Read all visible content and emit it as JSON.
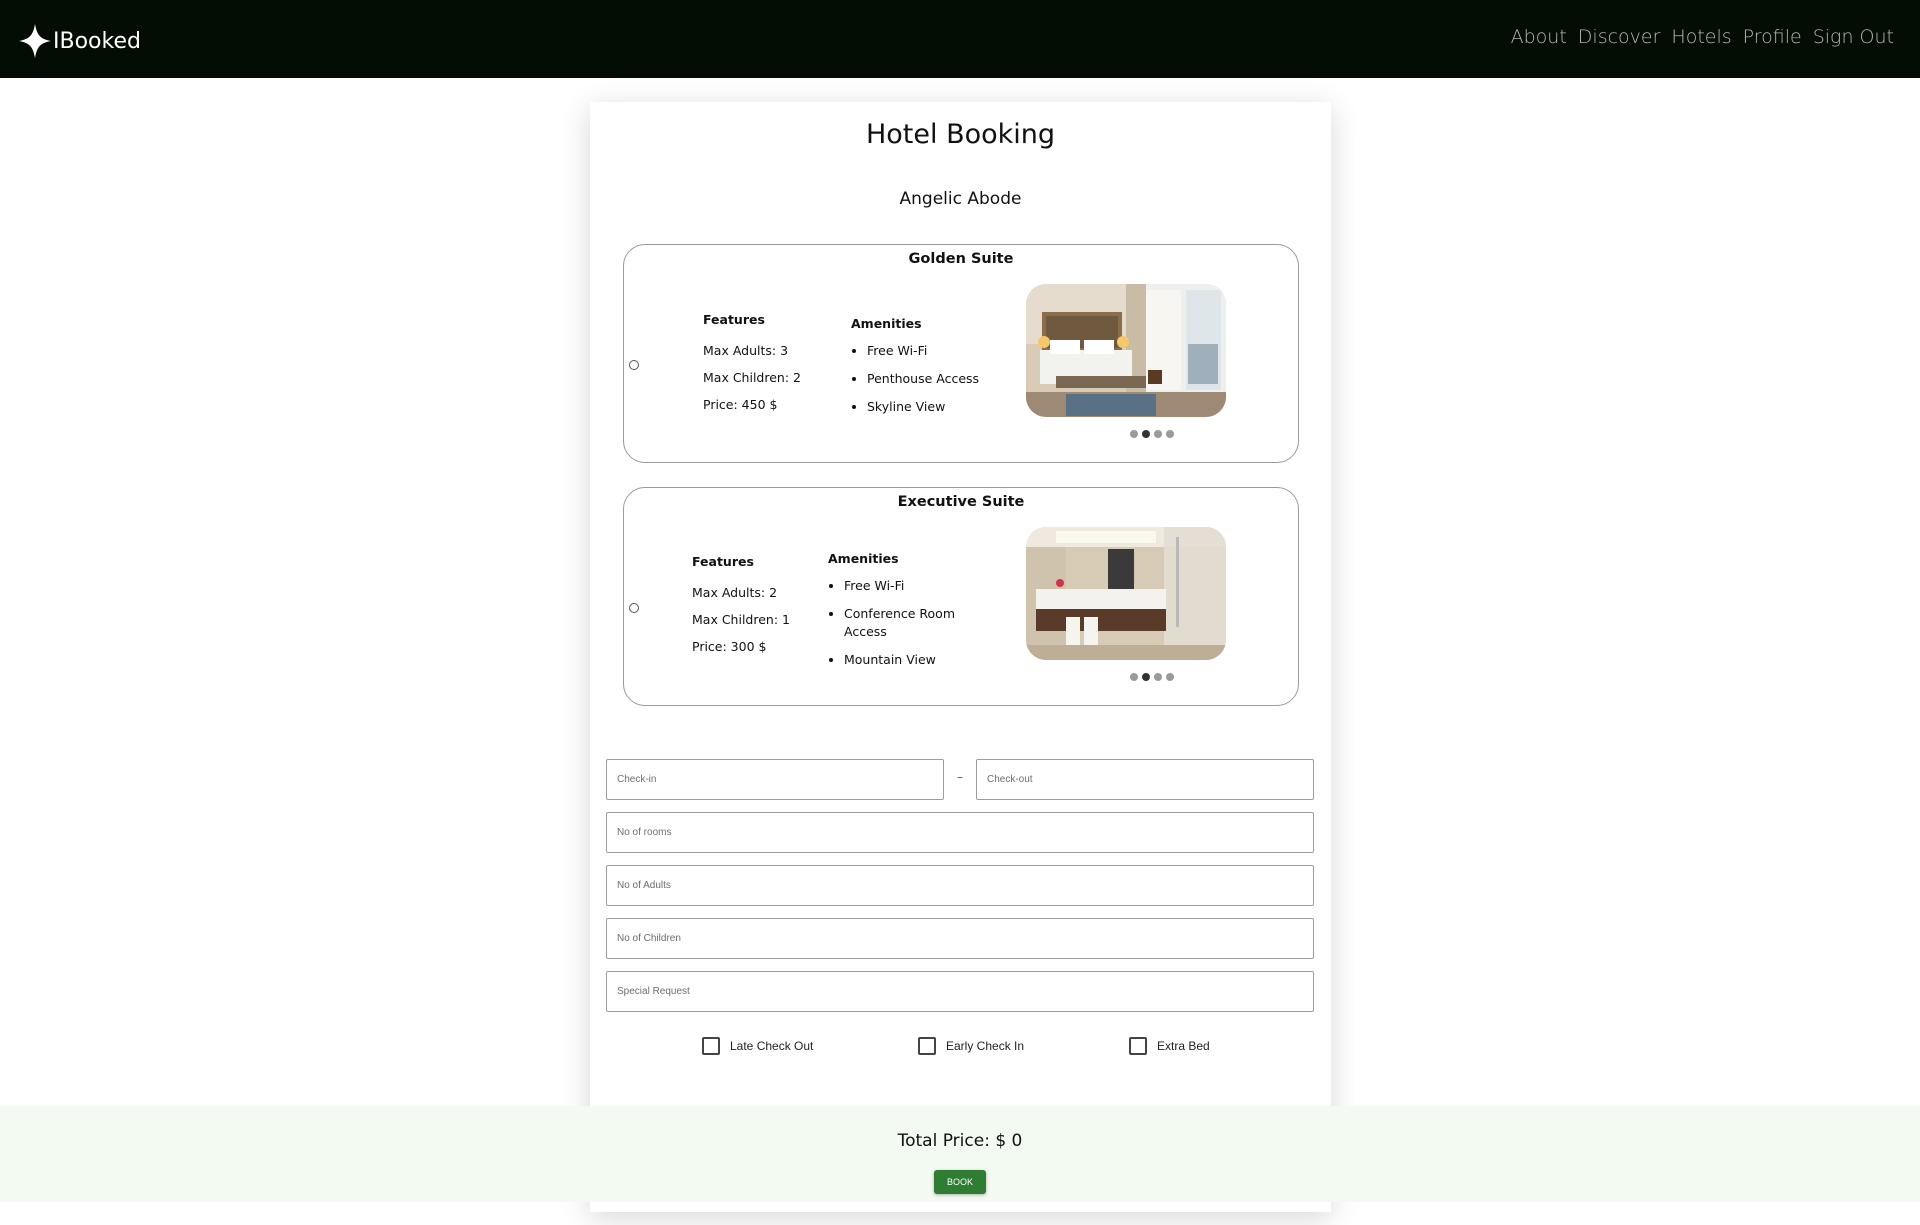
{
  "nav": {
    "brand": "IBooked",
    "links": [
      "About",
      "Discover",
      "Hotels",
      "Profile",
      "Sign Out"
    ]
  },
  "page": {
    "title": "Hotel Booking",
    "hotel_name": "Angelic Abode"
  },
  "rooms": [
    {
      "name": "Golden Suite",
      "features_heading": "Features",
      "features": [
        "Max Adults: 3",
        "Max Children: 2",
        "Price: 450 $"
      ],
      "amenities_heading": "Amenities",
      "amenities": [
        "Free Wi-Fi",
        "Penthouse Access",
        "Skyline View"
      ],
      "image_icon": "bedroom-photo",
      "carousel_active_index": 1,
      "carousel_count": 4
    },
    {
      "name": "Executive Suite",
      "features_heading": "Features",
      "features": [
        "Max Adults: 2",
        "Max Children: 1",
        "Price: 300 $"
      ],
      "amenities_heading": "Amenities",
      "amenities": [
        "Free Wi-Fi",
        "Conference Room Access",
        "Mountain View"
      ],
      "image_icon": "bathroom-photo",
      "carousel_active_index": 1,
      "carousel_count": 4
    }
  ],
  "form": {
    "checkin_placeholder": "Check-in",
    "date_separator": "–",
    "checkout_placeholder": "Check-out",
    "rooms_placeholder": "No of rooms",
    "adults_placeholder": "No of Adults",
    "children_placeholder": "No of Children",
    "request_placeholder": "Special Request",
    "options": [
      "Late Check Out",
      "Early Check In",
      "Extra Bed"
    ]
  },
  "footer": {
    "total_label": "Total Price: $ 0",
    "book_label": "BOOK"
  },
  "colors": {
    "navbar": "#030d03",
    "book_button": "#2e7d32",
    "footer_bg": "#f3faf1"
  }
}
